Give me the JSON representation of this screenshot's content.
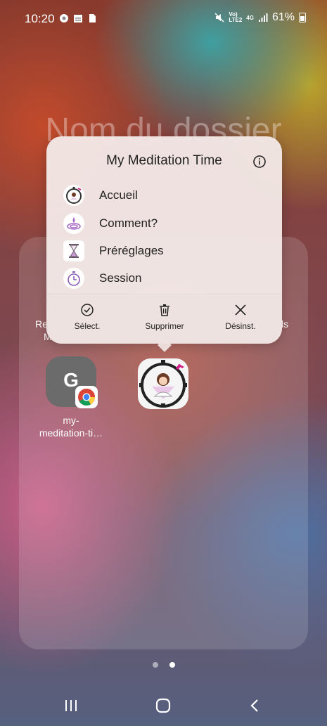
{
  "status": {
    "time": "10:20",
    "network_top": "Vo)",
    "network_bottom": "LTE2",
    "mobile_type": "4G",
    "battery": "61%"
  },
  "folder": {
    "title": "Nom du dossier",
    "hidden_labels": [
      "Re",
      "M",
      "ls"
    ],
    "apps": [
      {
        "label": "my-\nmeditation-ti…",
        "icon": "chrome-shortcut-icon",
        "letter": "G"
      },
      {
        "label": "",
        "icon": "meditation-app-icon"
      }
    ]
  },
  "popup": {
    "title": "My Meditation Time",
    "shortcuts": [
      {
        "label": "Accueil",
        "icon": "timer-meditator-icon"
      },
      {
        "label": "Comment?",
        "icon": "water-drop-icon"
      },
      {
        "label": "Préréglages",
        "icon": "hourglass-icon"
      },
      {
        "label": "Session",
        "icon": "stopwatch-icon"
      }
    ],
    "actions": [
      {
        "label": "Sélect.",
        "icon": "check-circle-icon"
      },
      {
        "label": "Supprimer",
        "icon": "trash-icon"
      },
      {
        "label": "Désinst.",
        "icon": "close-icon"
      }
    ]
  },
  "page_dots": {
    "count": 2,
    "active_index": 1
  },
  "nav": {
    "items": [
      "recent-apps",
      "home",
      "back"
    ]
  }
}
